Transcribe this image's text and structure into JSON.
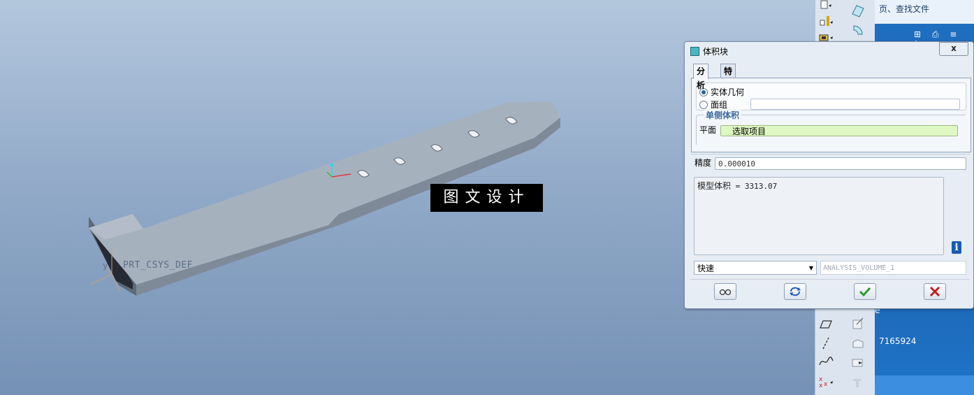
{
  "viewport": {
    "csys_label": "PRT_CSYS_DEF",
    "csys_axis": "y",
    "watermark": "图文设计"
  },
  "side_panel": {
    "top_text": "页、查找文件",
    "icon_row": "⊞ ⎙ ≡ ˄",
    "partial_char": "e",
    "number_text": "7165924"
  },
  "dialog": {
    "title": "体积块",
    "close_label": "x",
    "tabs": [
      {
        "label": "分析",
        "active": true
      },
      {
        "label": "特征",
        "active": false
      }
    ],
    "geometry": {
      "options": [
        {
          "label": "实体几何",
          "selected": true
        },
        {
          "label": "面组",
          "selected": false
        }
      ],
      "quilt_value": ""
    },
    "one_sided_volume": {
      "title": "单侧体积",
      "plane_label": "平面",
      "plane_value": "选取项目"
    },
    "precision": {
      "label": "精度",
      "value": "0.000010"
    },
    "result": {
      "label": "模型体积",
      "value": "= 3313.07"
    },
    "mode_select": "快速",
    "analysis_name": "ANALYSIS_VOLUME_1",
    "buttons": [
      "preview",
      "repeat",
      "ok",
      "cancel"
    ]
  },
  "colors": {
    "viewport_top": "#b3c7dd",
    "viewport_bottom": "#7591b5",
    "ok_green": "#2e9b2e",
    "cancel_red": "#c01f1f",
    "plane_input_bg": "#dff7c3"
  }
}
